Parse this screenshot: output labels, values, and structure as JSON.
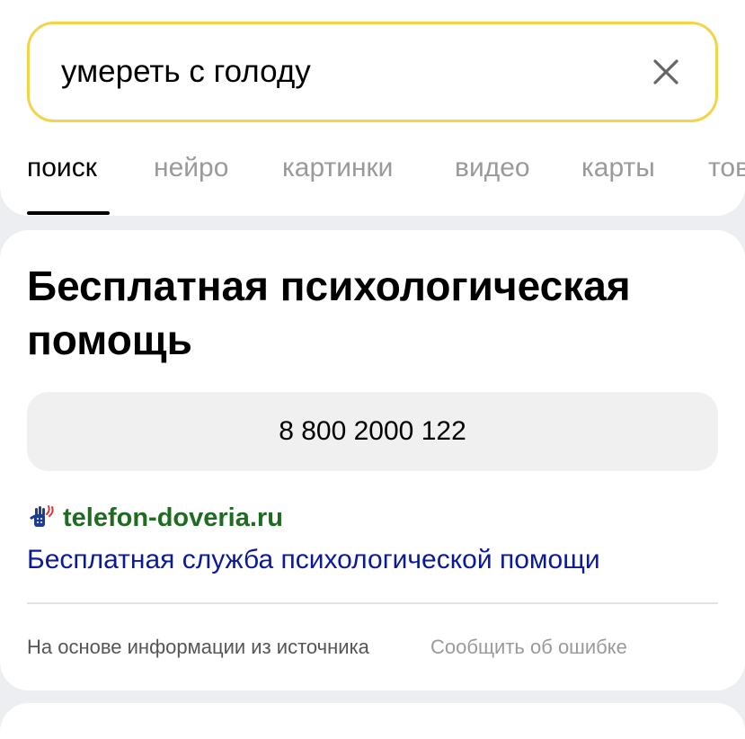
{
  "search": {
    "query": "умереть с голоду",
    "clear_icon": "close-icon",
    "border_color": "#f3d448"
  },
  "tabs": [
    {
      "label": "поиск",
      "active": true
    },
    {
      "label": "нейро",
      "active": false
    },
    {
      "label": "картинки",
      "active": false
    },
    {
      "label": "видео",
      "active": false
    },
    {
      "label": "карты",
      "active": false
    },
    {
      "label": "тов",
      "active": false
    }
  ],
  "result": {
    "title": "Бесплатная психологическая помощь",
    "phone": "8 800 2000 122",
    "favicon": "hands-icon",
    "domain": "telefon-doveria.ru",
    "link_text": "Бесплатная служба психологической помощи",
    "footer_note": "На основе информации из источника",
    "report_label": "Сообщить об ошибке"
  },
  "colors": {
    "domain": "#1f6b22",
    "link": "#0a1a99",
    "muted": "#9a9a9a",
    "page_bg": "#eceef2"
  }
}
